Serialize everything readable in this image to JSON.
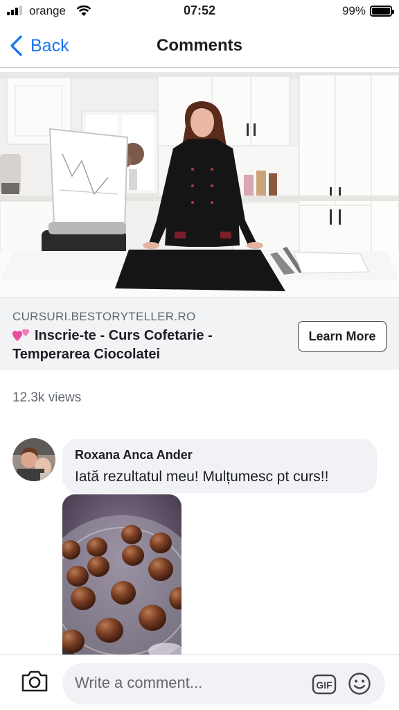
{
  "status_bar": {
    "carrier": "orange",
    "time": "07:52",
    "battery": "99%"
  },
  "nav": {
    "back_label": "Back",
    "title": "Comments"
  },
  "ad": {
    "domain": "CURSURI.BESTORYTELLER.RO",
    "headline": "Inscrie-te - Curs Cofetarie - Temperarea Ciocolatei",
    "cta_label": "Learn More"
  },
  "post": {
    "views": "12.3k views"
  },
  "comment": {
    "author": "Roxana Anca Ander",
    "text": "Iată rezultatul meu! Mulțumesc pt curs!!"
  },
  "composer": {
    "placeholder": "Write a comment..."
  },
  "icons": {
    "back": "chevron-left-icon",
    "heart": "two-hearts-icon",
    "camera": "camera-icon",
    "gif": "gif-icon",
    "emoji": "emoji-icon"
  },
  "colors": {
    "accent": "#1877f2",
    "bubble": "#f0f2f5",
    "muted_text": "#606770",
    "ad_footer_bg": "#f2f3f5"
  }
}
